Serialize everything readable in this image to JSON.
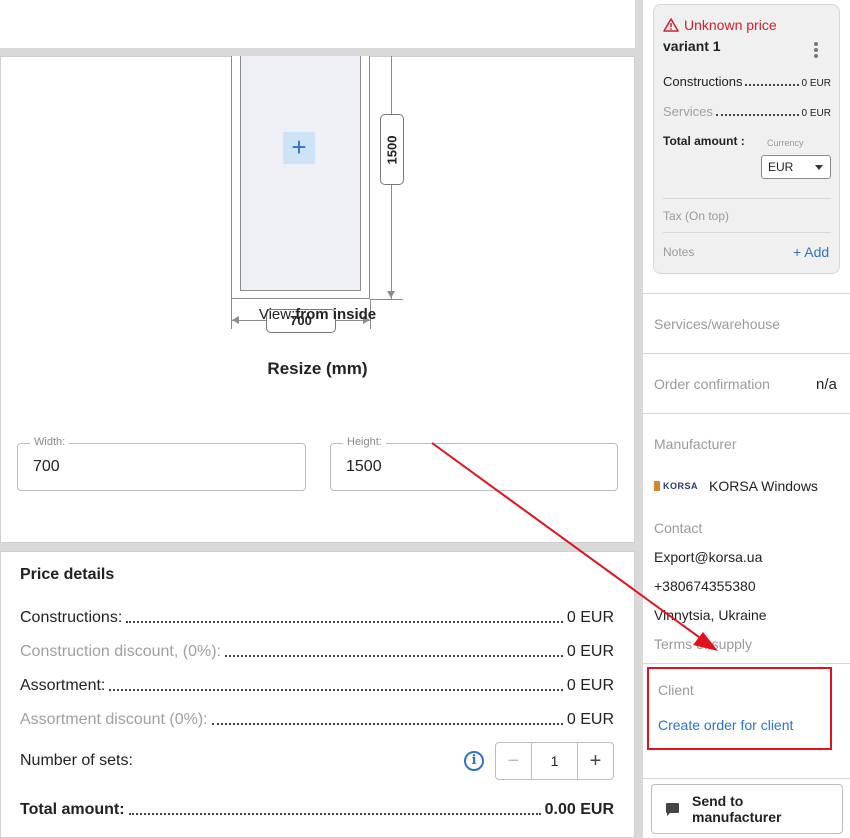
{
  "drawing": {
    "width_dim": "700",
    "height_dim": "1500",
    "view_prefix": "View:",
    "view_value": "from inside",
    "resize_title": "Resize (mm)"
  },
  "resize": {
    "width_label": "Width:",
    "width_value": "700",
    "height_label": "Height:",
    "height_value": "1500"
  },
  "price_details": {
    "title": "Price details",
    "rows": [
      {
        "label": "Constructions:",
        "value": "0 EUR"
      },
      {
        "label": "Construction discount, (0%):",
        "value": "0 EUR"
      },
      {
        "label": "Assortment:",
        "value": "0 EUR"
      },
      {
        "label": "Assortment discount (0%):",
        "value": "0 EUR"
      }
    ],
    "sets_label": "Number of sets:",
    "sets_value": "1",
    "total_label": "Total amount:",
    "total_value": "0.00 EUR"
  },
  "variant_card": {
    "status": "Unknown price",
    "name": "variant 1",
    "constructions_label": "Constructions",
    "constructions_value": "0 EUR",
    "services_label": "Services",
    "services_value": "0 EUR",
    "total_label": "Total amount :",
    "currency_label": "Currency",
    "currency_value": "EUR",
    "tax_label": "Tax (On top)",
    "notes_label": "Notes",
    "add_label": "+ Add"
  },
  "sidebar": {
    "services_warehouse": "Services/warehouse",
    "order_confirmation": "Order confirmation",
    "order_confirmation_value": "n/a",
    "manufacturer_label": "Manufacturer",
    "manufacturer_logo_text": "KORSA",
    "manufacturer_name": "KORSA Windows",
    "contact_label": "Contact",
    "email": "Export@korsa.ua",
    "phone": "+380674355380",
    "location": "Vinnytsia, Ukraine",
    "terms": "Terms of supply",
    "client_label": "Client",
    "create_order": "Create order for client",
    "send_button": "Send to manufacturer"
  },
  "colors": {
    "accent": "#2d74c9",
    "warning": "#d0202f",
    "annotation": "#e3101d"
  }
}
